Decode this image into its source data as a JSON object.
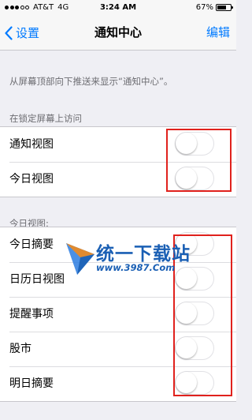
{
  "status_bar": {
    "carrier": "AT&T",
    "network": "4G",
    "time": "3:24 AM",
    "battery_percent": "67%",
    "battery_level": 0.67
  },
  "nav": {
    "back_label": "设置",
    "title": "通知中心",
    "edit_label": "编辑"
  },
  "info_text": "从屏幕顶部向下推送来显示“通知中心”。",
  "lock_screen_section": {
    "header": "在锁定屏幕上访问",
    "items": [
      {
        "label": "通知视图",
        "enabled": false
      },
      {
        "label": "今日视图",
        "enabled": false
      }
    ]
  },
  "today_section": {
    "header": "今日视图:",
    "items": [
      {
        "label": "今日摘要",
        "enabled": false
      },
      {
        "label": "日历日视图",
        "enabled": false
      },
      {
        "label": "提醒事项",
        "enabled": false
      },
      {
        "label": "股市",
        "enabled": false
      },
      {
        "label": "明日摘要",
        "enabled": false
      }
    ]
  },
  "watermark": {
    "title": "统一下载站",
    "url": "www.3987.Com"
  },
  "colors": {
    "accent": "#007aff",
    "highlight": "#e0211d",
    "watermark": "#1a5fb4"
  }
}
